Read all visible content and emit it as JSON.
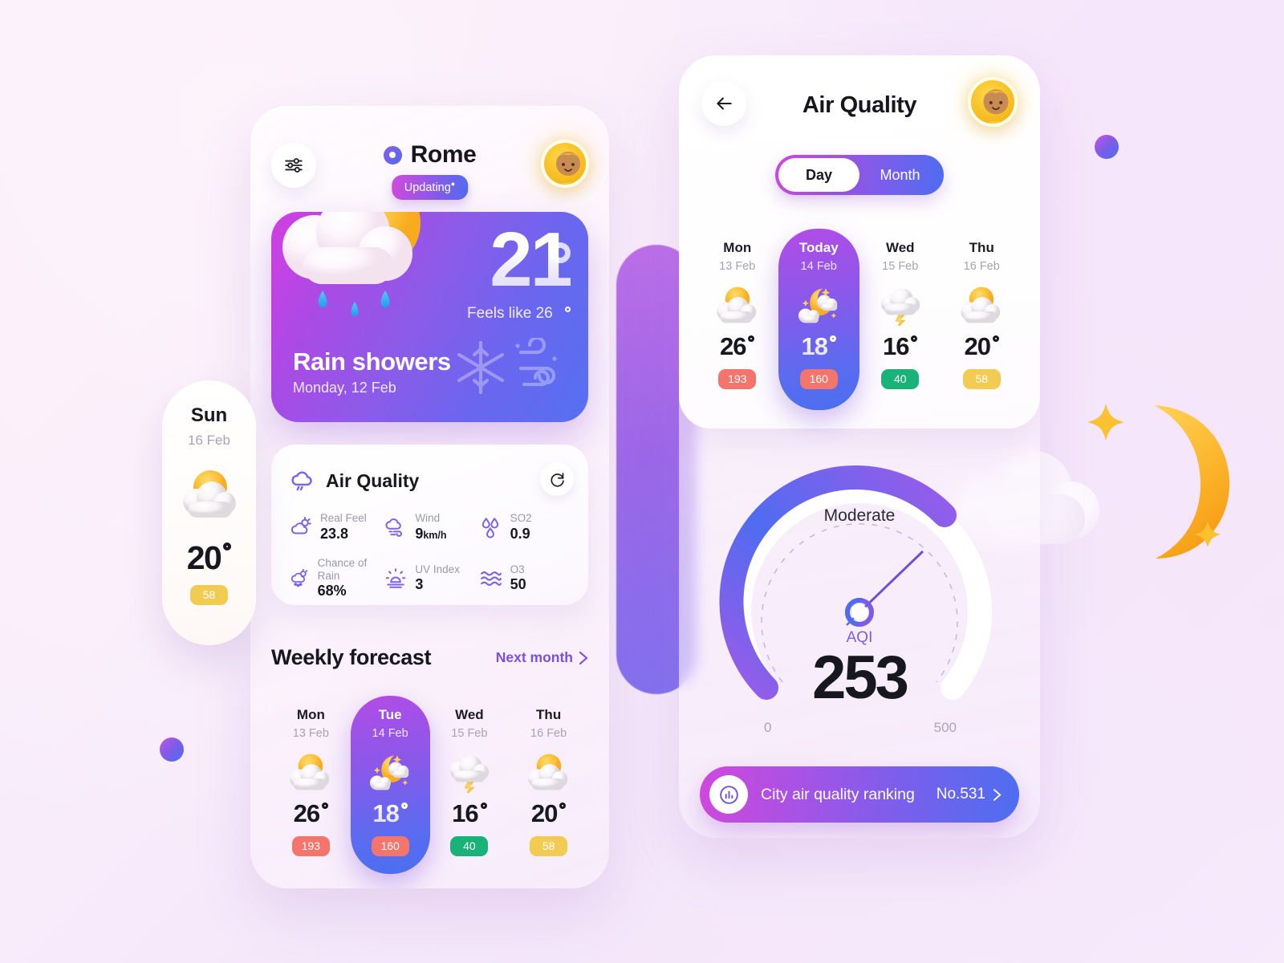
{
  "left_phone": {
    "filter_icon": "sliders-icon",
    "location_icon": "location-pin-icon",
    "city": "Rome",
    "status_badge": "Updating",
    "avatar": "user-avatar",
    "hero": {
      "temperature": "21",
      "feels_like": "Feels like 26",
      "condition": "Rain showers",
      "date": "Monday, 12 Feb",
      "weather_icon": "sun-behind-cloud-with-rain-icon",
      "glyphs": [
        "snowflake-icon",
        "wind-icon"
      ]
    },
    "air_quality": {
      "title": "Air Quality",
      "title_icon": "rain-cloud-icon",
      "refresh_icon": "refresh-icon",
      "metrics": [
        {
          "label": "Real Feel",
          "value": "23.8",
          "unit": "",
          "icon": "sun-cloud-icon"
        },
        {
          "label": "Wind",
          "value": "9",
          "unit": "km/h",
          "icon": "wind-cloud-icon"
        },
        {
          "label": "SO2",
          "value": "0.9",
          "unit": "",
          "icon": "droplets-icon"
        },
        {
          "label": "Chance of Rain",
          "value": "68%",
          "unit": "",
          "icon": "rain-sun-icon"
        },
        {
          "label": "UV Index",
          "value": "3",
          "unit": "",
          "icon": "uv-sun-icon"
        },
        {
          "label": "O3",
          "value": "50",
          "unit": "",
          "icon": "waves-icon"
        }
      ]
    },
    "weekly": {
      "title": "Weekly forecast",
      "link": "Next month",
      "link_icon": "chevron-right-icon",
      "days": [
        {
          "name": "Mon",
          "date": "13 Feb",
          "temp": "26",
          "aqi": "193",
          "aqi_color": "#f4756b",
          "icon": "sun-cloud-icon",
          "active": false
        },
        {
          "name": "Tue",
          "date": "14 Feb",
          "temp": "18",
          "aqi": "160",
          "aqi_color": "#f4756b",
          "icon": "moon-cloud-stars-icon",
          "active": true
        },
        {
          "name": "Wed",
          "date": "15 Feb",
          "temp": "16",
          "aqi": "40",
          "aqi_color": "#19b37a",
          "icon": "thunder-cloud-icon",
          "active": false
        },
        {
          "name": "Thu",
          "date": "16 Feb",
          "temp": "20",
          "aqi": "58",
          "aqi_color": "#f2cb52",
          "icon": "sun-cloud-icon",
          "active": false
        }
      ]
    }
  },
  "floating_card": {
    "name": "Sun",
    "date": "16 Feb",
    "temp": "20",
    "aqi": "58",
    "aqi_color": "#f2cb52",
    "icon": "sun-cloud-icon"
  },
  "right_phone": {
    "back_icon": "arrow-left-icon",
    "title": "Air Quality",
    "avatar": "user-avatar",
    "segments": [
      {
        "label": "Day",
        "active": true
      },
      {
        "label": "Month",
        "active": false
      }
    ],
    "days": [
      {
        "name": "Mon",
        "date": "13 Feb",
        "temp": "26",
        "aqi": "193",
        "aqi_color": "#f4756b",
        "icon": "sun-cloud-icon",
        "active": false
      },
      {
        "name": "Today",
        "date": "14 Feb",
        "temp": "18",
        "aqi": "160",
        "aqi_color": "#f4756b",
        "icon": "moon-cloud-stars-icon",
        "active": true
      },
      {
        "name": "Wed",
        "date": "15 Feb",
        "temp": "16",
        "aqi": "40",
        "aqi_color": "#19b37a",
        "icon": "thunder-cloud-icon",
        "active": false
      },
      {
        "name": "Thu",
        "date": "16 Feb",
        "temp": "20",
        "aqi": "58",
        "aqi_color": "#f2cb52",
        "icon": "sun-cloud-icon",
        "active": false
      }
    ],
    "gauge": {
      "status": "Moderate",
      "caption": "AQI",
      "value": "253",
      "min": "0",
      "max": "500"
    },
    "ranking": {
      "icon": "bar-chart-icon",
      "label": "City air quality ranking",
      "value": "No.531",
      "chevron": "chevron-right-icon"
    }
  },
  "decor": {
    "moon_icon": "crescent-moon-icon",
    "cloud_icon": "cloud-icon",
    "star_icon": "star-icon",
    "orb_color": "#8a5ce8"
  },
  "chart_data": {
    "type": "gauge",
    "title": "AQI",
    "value": 253,
    "min": 0,
    "max": 500,
    "status": "Moderate",
    "arc_start_deg": 140,
    "arc_sweep_deg": 260
  }
}
